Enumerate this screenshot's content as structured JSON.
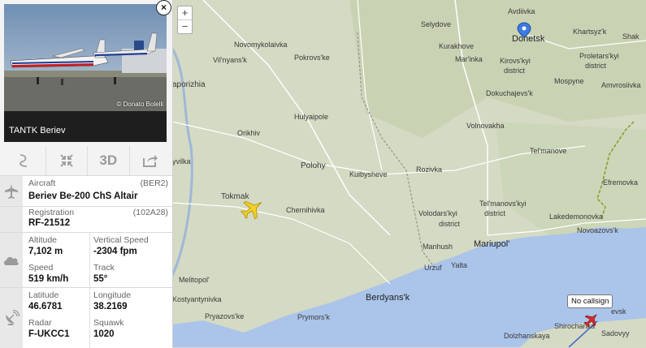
{
  "photo": {
    "credit": "© Donato Bolelli",
    "aircraft_name": "TANTK Beriev"
  },
  "toolbar": {
    "route_icon": "route-icon",
    "fullscreen_icon": "fullscreen-icon",
    "three_d_label": "3D",
    "share_icon": "share-icon"
  },
  "aircraft": {
    "label": "Aircraft",
    "code": "(BER2)",
    "value": "Beriev Be-200 ChS Altair"
  },
  "registration": {
    "label": "Registration",
    "code": "(102A28)",
    "value": "RF-21512"
  },
  "altitude": {
    "label": "Altitude",
    "value": "7,102 m"
  },
  "vertical_speed": {
    "label": "Vertical Speed",
    "value": "-2304 fpm"
  },
  "speed": {
    "label": "Speed",
    "value": "519 km/h"
  },
  "track": {
    "label": "Track",
    "value": "55°"
  },
  "latitude": {
    "label": "Latitude",
    "value": "46.6781"
  },
  "longitude": {
    "label": "Longitude",
    "value": "38.2169"
  },
  "radar": {
    "label": "Radar",
    "value": "F-UKCC1"
  },
  "squawk": {
    "label": "Squawk",
    "value": "1020"
  },
  "zoom": {
    "in": "+",
    "out": "−"
  },
  "tooltip": {
    "label": "No callsign"
  },
  "map_labels": {
    "avdiivka": "Avdiivka",
    "selydove": "Selydove",
    "donetsk": "Donetsk",
    "khartsyzk": "Khartsyz'k",
    "shak": "Shak",
    "novomykolaivka": "Novomykolaivka",
    "pokrovske": "Pokrovs'ke",
    "kurakhove": "Kurakhove",
    "marinka": "Mar'inka",
    "kirovskyi": "Kirovs'kyi",
    "district1": "district",
    "proletarskyi": "Proletars'kyi",
    "district2": "district",
    "vilnyansk": "Vil'nyans'k",
    "aporizhia": "aporizhia",
    "mospyne": "Mospyne",
    "dokuchaievsk": "Dokuchajevs'k",
    "amvrosiivka": "Amvrosiivka",
    "hulyaipole": "Hulyaipole",
    "orikhiv": "Orikhiv",
    "volnovakha": "Volnovakha",
    "telmanove": "Tel'manove",
    "yvilka": "yvilka",
    "polohy": "Polohy",
    "kuibysheve": "Kuibysheve",
    "rozivka": "Rozivka",
    "efremovka": "Efremovka",
    "tokmak": "Tokmak",
    "chernihivka": "Chernihivka",
    "volodarskyi": "Volodars'kyi",
    "district3": "district",
    "telmanovskyi": "Tel'manovs'kyi",
    "district4": "district",
    "lakedemonovka": "Lakedemonovka",
    "novoazovsk": "Novoazovs'k",
    "mariupol": "Mariupol'",
    "manhush": "Manhush",
    "urzuf": "Urzuf",
    "yalta": "Yalta",
    "melitopol": "Melitopol'",
    "kostyantynivka": "Kostyantynivka",
    "berdyansk": "Berdyans'k",
    "prymorsk": "Prymors'k",
    "pryazovske": "Pryazovs'ke",
    "yevsk": "evsk",
    "shirochanka": "Shirochanka",
    "sadovyy": "Sadovyy",
    "dolzhanskaya": "Dolzhanskaya"
  },
  "colors": {
    "accent_plane": "#f4d028",
    "sea": "#aac4ea",
    "land": "#d6dcc6",
    "panel_bg": "#f3f3f3"
  }
}
